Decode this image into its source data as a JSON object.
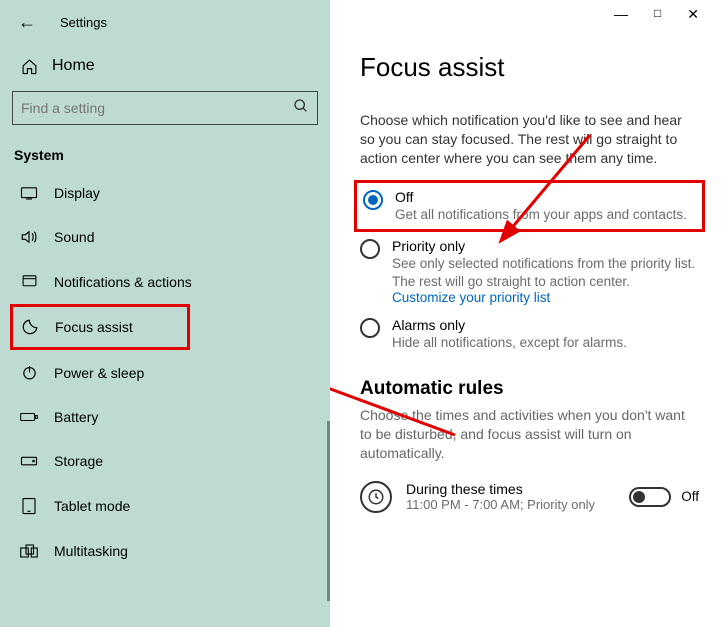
{
  "titlebar": {
    "title": "Settings"
  },
  "sidebar": {
    "home": "Home",
    "search_placeholder": "Find a setting",
    "section": "System",
    "items": [
      {
        "label": "Display"
      },
      {
        "label": "Sound"
      },
      {
        "label": "Notifications & actions"
      },
      {
        "label": "Focus assist"
      },
      {
        "label": "Power & sleep"
      },
      {
        "label": "Battery"
      },
      {
        "label": "Storage"
      },
      {
        "label": "Tablet mode"
      },
      {
        "label": "Multitasking"
      }
    ]
  },
  "main": {
    "heading": "Focus assist",
    "description": "Choose which notification you'd like to see and hear so you can stay focused. The rest will go straight to action center where you can see them any time.",
    "options": {
      "off": {
        "label": "Off",
        "sub": "Get all notifications from your apps and contacts."
      },
      "priority": {
        "label": "Priority only",
        "sub": "See only selected notifications from the priority list. The rest will go straight to action center.",
        "link": "Customize your priority list"
      },
      "alarms": {
        "label": "Alarms only",
        "sub": "Hide all notifications, except for alarms."
      }
    },
    "auto": {
      "heading": "Automatic rules",
      "description": "Choose the times and activities when you don't want to be disturbed, and focus assist will turn on automatically.",
      "rule1": {
        "title": "During these times",
        "sub": "11:00 PM - 7:00 AM; Priority only",
        "state": "Off"
      }
    }
  }
}
